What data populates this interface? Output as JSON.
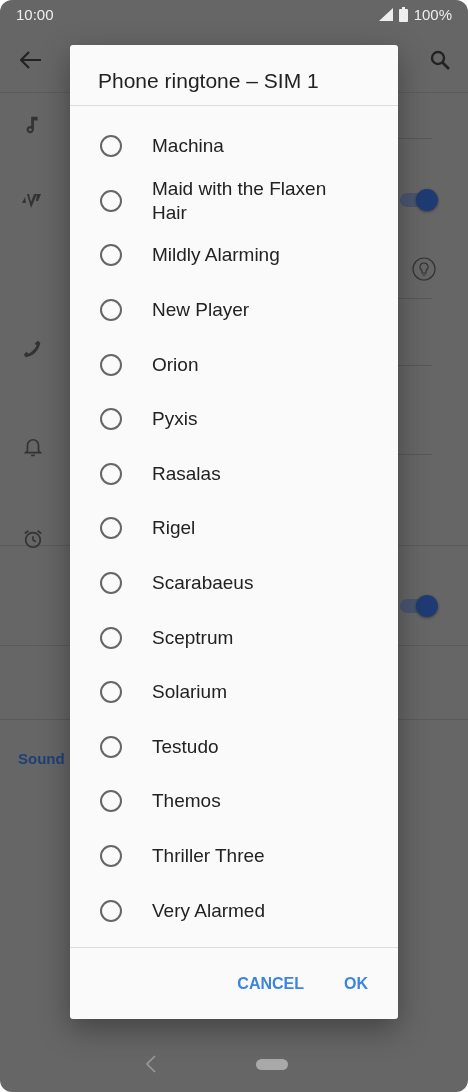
{
  "status_bar": {
    "time": "10:00",
    "battery": "100%"
  },
  "settings": {
    "rows": [
      {
        "kind": "plain"
      },
      {
        "kind": "toggle",
        "on": true
      },
      {
        "kind": "info"
      },
      {
        "kind": "plain"
      },
      {
        "kind": "plain"
      },
      {
        "kind": "plain"
      },
      {
        "kind": "toggle",
        "on": true
      },
      {
        "kind": "blank"
      }
    ],
    "section_header": "Sound"
  },
  "dialog": {
    "title": "Phone ringtone – SIM 1",
    "options": [
      {
        "label": "Machina",
        "selected": false
      },
      {
        "label": "Maid with the Flaxen Hair",
        "selected": false
      },
      {
        "label": "Mildly Alarming",
        "selected": false
      },
      {
        "label": "New Player",
        "selected": false
      },
      {
        "label": "Orion",
        "selected": false
      },
      {
        "label": "Pyxis",
        "selected": false
      },
      {
        "label": "Rasalas",
        "selected": false
      },
      {
        "label": "Rigel",
        "selected": false
      },
      {
        "label": "Scarabaeus",
        "selected": false
      },
      {
        "label": "Sceptrum",
        "selected": false
      },
      {
        "label": "Solarium",
        "selected": false
      },
      {
        "label": "Testudo",
        "selected": false
      },
      {
        "label": "Themos",
        "selected": false
      },
      {
        "label": "Thriller Three",
        "selected": false
      },
      {
        "label": "Very Alarmed",
        "selected": false
      }
    ],
    "buttons": [
      "CANCEL",
      "OK"
    ]
  }
}
